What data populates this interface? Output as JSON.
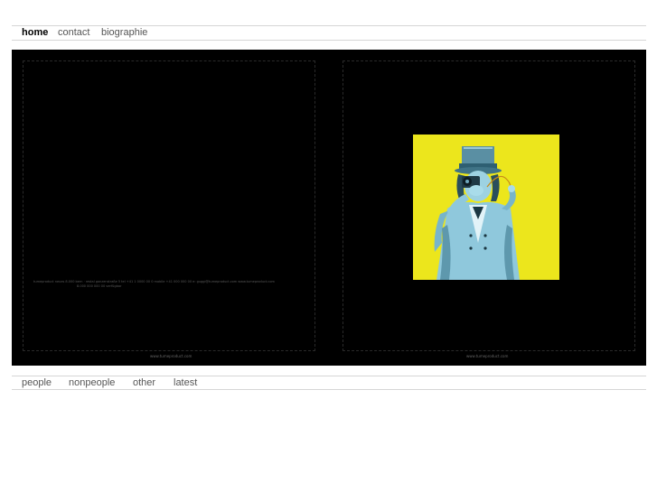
{
  "top_nav": {
    "items": [
      {
        "label": "home"
      },
      {
        "label": "contact"
      },
      {
        "label": "biographie"
      }
    ]
  },
  "left_card": {
    "address_line_1": "tumeproduct    neues    8.000 bern · restal ganzenstraße 5   tel +41 1 0000 00 0   mobile +41 000 000 00   e: guggi@tumeproduct.com   www.tumeproduct.com",
    "address_line_2": "8.000 000 000 00   verfügbar",
    "website": "www.tumeproduct.com"
  },
  "right_card": {
    "website": "www.tumeproduct.com"
  },
  "colors": {
    "artwork_background": "#ece61c",
    "stage_background": "#000000"
  },
  "bottom_nav": {
    "items": [
      {
        "label": "people"
      },
      {
        "label": "nonpeople"
      },
      {
        "label": "other"
      },
      {
        "label": "latest"
      }
    ]
  }
}
